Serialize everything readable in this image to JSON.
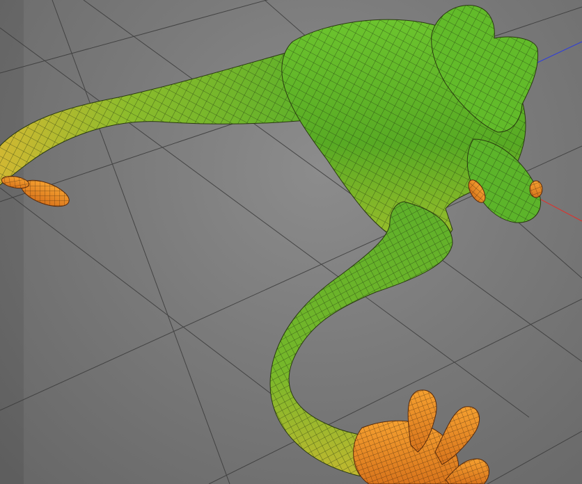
{
  "viewport": {
    "name": "3D Viewport",
    "background_color": "#7a7a7a",
    "grid_color": "#3a3a3a",
    "axes": {
      "x_color": "#e0302a",
      "y_color": "#2ac42a",
      "z_color": "#2a3ae0"
    },
    "model": {
      "name": "frog",
      "display_mode": "wireframe-on-shaded",
      "body_color": "#5fb52a",
      "body_color_dark": "#3f8a18",
      "belly_color": "#a8c42e",
      "toe_color": "#f08a2a",
      "wire_color": "#1a2a0e"
    }
  }
}
